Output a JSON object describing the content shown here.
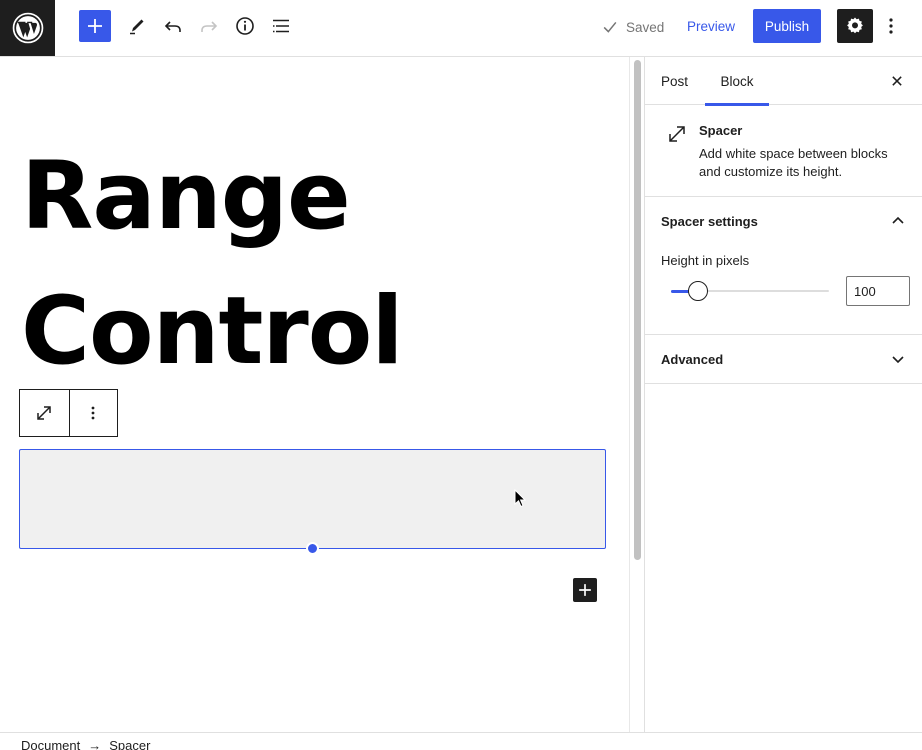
{
  "header": {
    "saved_label": "Saved",
    "preview_label": "Preview",
    "publish_label": "Publish"
  },
  "editor": {
    "title_line_1": "Range",
    "title_line_2": "Control"
  },
  "sidebar": {
    "tabs": [
      {
        "label": "Post"
      },
      {
        "label": "Block"
      }
    ],
    "active_tab": "Block",
    "block_card": {
      "title": "Spacer",
      "description": "Add white space between blocks and customize its height."
    },
    "spacer_settings": {
      "title": "Spacer settings",
      "height_label": "Height in pixels",
      "height_value": "100",
      "slider_fraction": 0.17
    },
    "advanced": {
      "title": "Advanced"
    }
  },
  "footer": {
    "breadcrumb": [
      "Document",
      "Spacer"
    ]
  },
  "colors": {
    "accent": "#3858e9",
    "dark": "#1e1e1e",
    "spacer_bg": "#f0f0f0"
  }
}
